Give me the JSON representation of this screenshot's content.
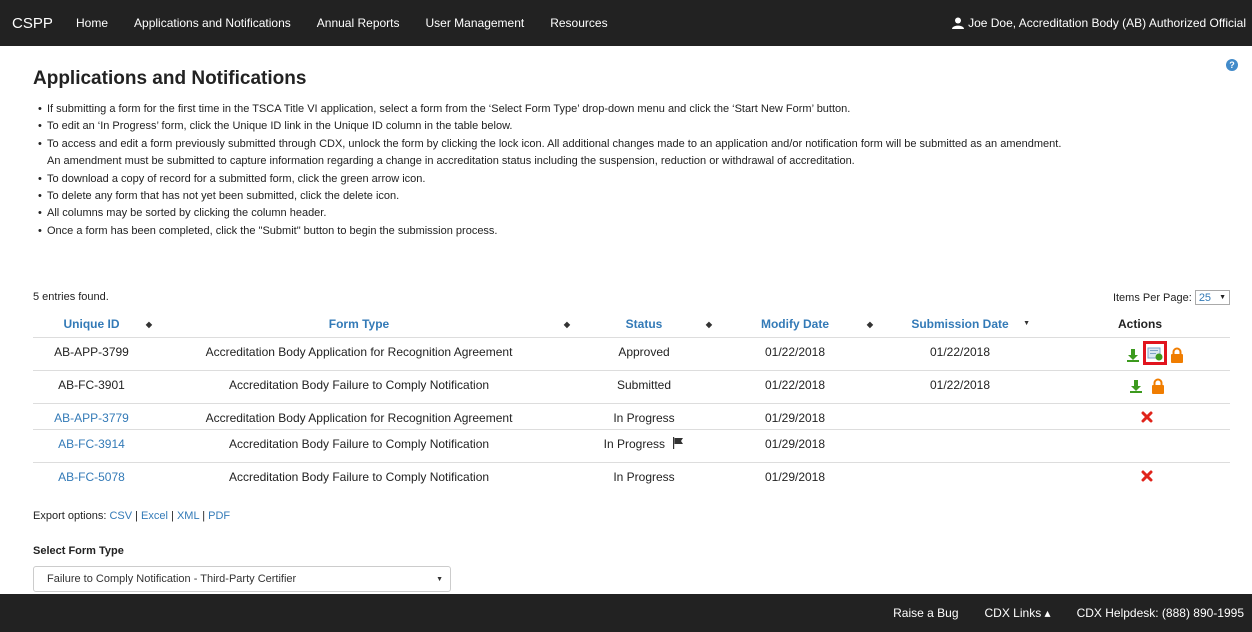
{
  "navbar": {
    "brand": "CSPP",
    "items": [
      "Home",
      "Applications and Notifications",
      "Annual Reports",
      "User Management",
      "Resources"
    ],
    "user": "Joe Doe, Accreditation Body (AB) Authorized Official"
  },
  "page": {
    "title": "Applications and Notifications",
    "instructions": [
      "If submitting a form for the first time in the TSCA Title VI application, select a form from the ‘Select Form Type’ drop-down menu and click the ‘Start New Form’ button.",
      "To edit an ‘In Progress’ form, click the Unique ID link in the Unique ID column in the table below.",
      "To access and edit a form previously submitted through CDX, unlock the form by clicking the lock icon. All additional changes made to an application and/or notification form will be submitted as an amendment.",
      "An amendment must be submitted to capture information regarding a change in accreditation status including the suspension, reduction or withdrawal of accreditation.",
      "To download a copy of record for a submitted form, click the green arrow icon.",
      "To delete any form that has not yet been submitted, click the delete icon.",
      "All columns may be sorted by clicking the column header.",
      "Once a form has been completed, click the \"Submit\" button to begin the submission process."
    ]
  },
  "table": {
    "entries_found": "5 entries found.",
    "items_per_page_label": "Items Per Page:",
    "items_per_page_value": "25",
    "headers": {
      "unique_id": "Unique ID",
      "form_type": "Form Type",
      "status": "Status",
      "modify_date": "Modify Date",
      "submission_date": "Submission Date",
      "actions": "Actions"
    },
    "rows": [
      {
        "id": "AB-APP-3799",
        "form_type": "Accreditation Body Application for Recognition Agreement",
        "status": "Approved",
        "modify": "01/22/2018",
        "submitted": "01/22/2018"
      },
      {
        "id": "AB-FC-3901",
        "form_type": "Accreditation Body Failure to Comply Notification",
        "status": "Submitted",
        "modify": "01/22/2018",
        "submitted": "01/22/2018"
      },
      {
        "id": "AB-APP-3779",
        "form_type": "Accreditation Body Application for Recognition Agreement",
        "status": "In Progress",
        "modify": "01/29/2018",
        "submitted": ""
      },
      {
        "id": "AB-FC-3914",
        "form_type": "Accreditation Body Failure to Comply Notification",
        "status": "In Progress",
        "modify": "01/29/2018",
        "submitted": ""
      },
      {
        "id": "AB-FC-5078",
        "form_type": "Accreditation Body Failure to Comply Notification",
        "status": "In Progress",
        "modify": "01/29/2018",
        "submitted": ""
      }
    ]
  },
  "export": {
    "label": "Export options:",
    "options": [
      "CSV",
      "Excel",
      "XML",
      "PDF"
    ]
  },
  "form_type": {
    "label": "Select Form Type",
    "selected": "Failure to Comply Notification - Third-Party Certifier"
  },
  "footer": {
    "raise_bug": "Raise a Bug",
    "cdx_links": "CDX Links ▴",
    "helpdesk": "CDX Helpdesk: (888) 890-1995"
  },
  "colors": {
    "navbar_bg": "#222222",
    "link": "#337ab7",
    "download_green": "#3c9a1e",
    "lock_orange": "#f07d00",
    "delete_red": "#e0241b",
    "highlight_red": "#e1141e"
  },
  "icons": [
    "user-icon",
    "help-icon",
    "download-icon",
    "edit-form-icon",
    "lock-icon",
    "delete-icon",
    "flag-icon",
    "sort-icon",
    "chevron-down-icon"
  ]
}
